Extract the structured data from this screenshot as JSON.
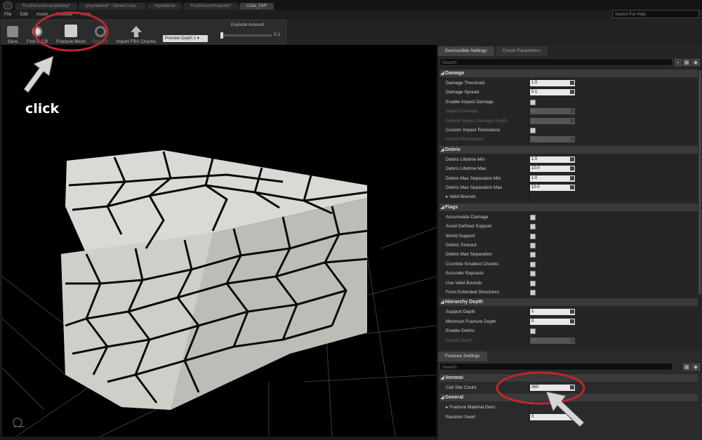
{
  "tabs": [
    {
      "label": "FirstPersonExampleMap*",
      "active": false
    },
    {
      "label": "phymaterial* - Generic Ass...",
      "active": false
    },
    {
      "label": "mymaterial",
      "active": false
    },
    {
      "label": "FirstPersonProjectile*",
      "active": false
    },
    {
      "label": "Cube_DM*",
      "active": true
    }
  ],
  "search_for_help": "Search For Help",
  "menu": [
    "File",
    "Edit",
    "Asset",
    "Window",
    "Help"
  ],
  "toolbar": {
    "save": "Save",
    "find": "Find in CB",
    "fracture_mesh": "Fracture Mesh",
    "refresh": "Refresh",
    "import_fbx": "Import FBX Chunks",
    "preview_depth": "Preview Depth 1 ▾",
    "explode_label": "Explode Amount",
    "explode_value": "0.1"
  },
  "annotation": {
    "click": "click"
  },
  "destructible": {
    "tabs": [
      "Destructible Settings",
      "Chunk Parameters"
    ],
    "search_placeholder": "Search",
    "damage": {
      "title": "Damage",
      "rows": [
        {
          "label": "Damage Threshold",
          "type": "value",
          "value": "1.0",
          "dim": false
        },
        {
          "label": "Damage Spread",
          "type": "value",
          "value": "0.1",
          "dim": false
        },
        {
          "label": "Enable Impact Damage",
          "type": "check",
          "dim": false
        },
        {
          "label": "Impact Damage",
          "type": "value",
          "value": "0.0",
          "dim": true
        },
        {
          "label": "Default Impact Damage Depth",
          "type": "value",
          "value": "1",
          "dim": true
        },
        {
          "label": "Custom Impact Resistance",
          "type": "check",
          "dim": false
        },
        {
          "label": "Impact Resistance",
          "type": "value",
          "value": "0.0",
          "dim": true
        }
      ]
    },
    "debris": {
      "title": "Debris",
      "rows": [
        {
          "label": "Debris Lifetime Min",
          "type": "value",
          "value": "1.0",
          "dim": false
        },
        {
          "label": "Debris Lifetime Max",
          "type": "value",
          "value": "10.0",
          "dim": false
        },
        {
          "label": "Debris Max Separation Min",
          "type": "value",
          "value": "1.0",
          "dim": false
        },
        {
          "label": "Debris Max Separation Max",
          "type": "value",
          "value": "10.0",
          "dim": false
        },
        {
          "label": "▸ Valid Bounds",
          "type": "none",
          "dim": false
        }
      ]
    },
    "flags": {
      "title": "Flags",
      "rows": [
        {
          "label": "Accumulate Damage",
          "type": "check",
          "dim": false
        },
        {
          "label": "Asset Defined Support",
          "type": "check",
          "dim": false
        },
        {
          "label": "World Support",
          "type": "check",
          "dim": false
        },
        {
          "label": "Debris Timeout",
          "type": "check",
          "dim": false
        },
        {
          "label": "Debris Max Separation",
          "type": "check",
          "dim": false
        },
        {
          "label": "Crumble Smallest Chunks",
          "type": "check",
          "dim": false
        },
        {
          "label": "Accurate Raycasts",
          "type": "check",
          "dim": false
        },
        {
          "label": "Use Valid Bounds",
          "type": "check",
          "dim": false
        },
        {
          "label": "Form Extended Structures",
          "type": "check",
          "dim": false
        }
      ]
    },
    "hierarchy": {
      "title": "Hierarchy Depth",
      "rows": [
        {
          "label": "Support Depth",
          "type": "value",
          "value": "1",
          "dim": false
        },
        {
          "label": "Minimum Fracture Depth",
          "type": "value",
          "value": "0",
          "dim": false
        },
        {
          "label": "Enable Debris",
          "type": "check",
          "dim": false
        },
        {
          "label": "Debris Depth",
          "type": "value",
          "value": "-1",
          "dim": true
        }
      ]
    }
  },
  "fracture": {
    "tab": "Fracture Settings",
    "search_placeholder": "Search",
    "voronoi": {
      "title": "Voronoi",
      "rows": [
        {
          "label": "Cell Site Count",
          "type": "value",
          "value": "360",
          "dim": false
        }
      ]
    },
    "general": {
      "title": "General",
      "rows": [
        {
          "label": "▸ Fracture Material Desc",
          "type": "none",
          "dim": false
        },
        {
          "label": "Random Seed",
          "type": "value",
          "value": "0",
          "dim": false
        }
      ]
    }
  },
  "colors": {
    "highlight": "#c0262c",
    "panel_bg": "#252525",
    "viewport_bg": "#000000"
  }
}
